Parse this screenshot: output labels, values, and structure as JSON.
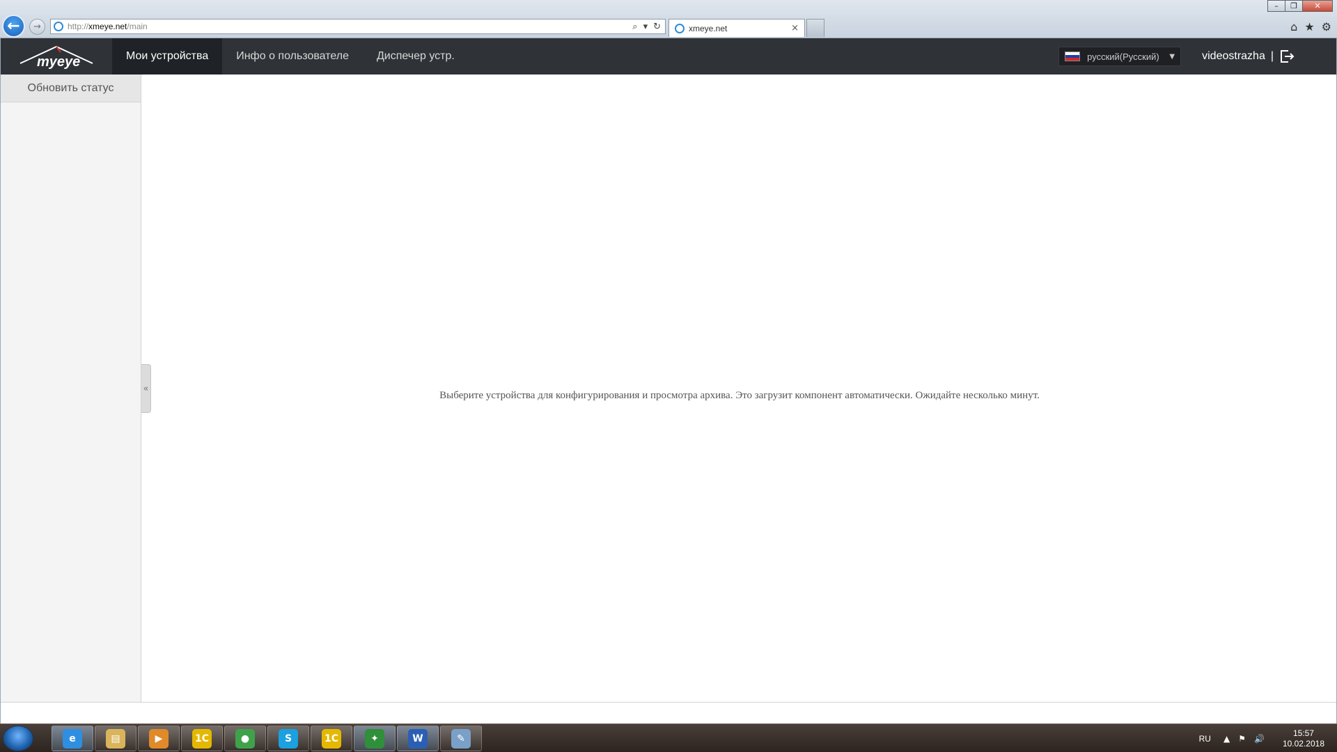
{
  "browser": {
    "url_protocol": "http://",
    "url_host": "xmeye.net",
    "url_path": "/main",
    "tab_title": "xmeye.net",
    "tab_close": "×",
    "window_buttons": [
      "–",
      "❐",
      "✕"
    ],
    "toolbar_icons": [
      "home-icon",
      "favorites-icon",
      "tools-icon"
    ]
  },
  "app": {
    "logo_text": "myeye",
    "nav": [
      {
        "label": "Мои устройства",
        "active": true
      },
      {
        "label": "Инфо о пользователе",
        "active": false
      },
      {
        "label": "Диспечер устр.",
        "active": false
      }
    ],
    "language": "русский(Русский)",
    "username": "videostrazha",
    "separator": "|"
  },
  "sidebar": {
    "refresh_label": "Обновить статус",
    "collapse_glyph": "«"
  },
  "main": {
    "message": "Выберите устройства для конфигурирования и просмотра архива. Это загрузит компонент автоматически. Ожидайте несколько минут."
  },
  "taskbar": {
    "items": [
      {
        "name": "internet-explorer",
        "glyph": "e",
        "color": "#2e8fe0",
        "active": true
      },
      {
        "name": "file-explorer",
        "glyph": "▤",
        "color": "#d9b45a",
        "active": false
      },
      {
        "name": "media-player",
        "glyph": "▶",
        "color": "#e08a2a",
        "active": false
      },
      {
        "name": "1c-app",
        "glyph": "1С",
        "color": "#e5b800",
        "active": false
      },
      {
        "name": "chrome",
        "glyph": "●",
        "color": "#3fa24a",
        "active": false
      },
      {
        "name": "skype",
        "glyph": "S",
        "color": "#1ba0e0",
        "active": false
      },
      {
        "name": "1c-app-2",
        "glyph": "1С",
        "color": "#e5b800",
        "active": false
      },
      {
        "name": "green-app",
        "glyph": "✦",
        "color": "#2f8f3a",
        "active": true
      },
      {
        "name": "word",
        "glyph": "W",
        "color": "#2b5fb4",
        "active": true
      },
      {
        "name": "paint",
        "glyph": "✎",
        "color": "#7aa0c8",
        "active": false
      }
    ],
    "language": "RU",
    "time": "15:57",
    "date": "10.02.2018"
  },
  "colors": {
    "header_bg": "#2f3237",
    "active_nav_bg": "#1f2226",
    "sidebar_bg": "#f4f4f4"
  }
}
